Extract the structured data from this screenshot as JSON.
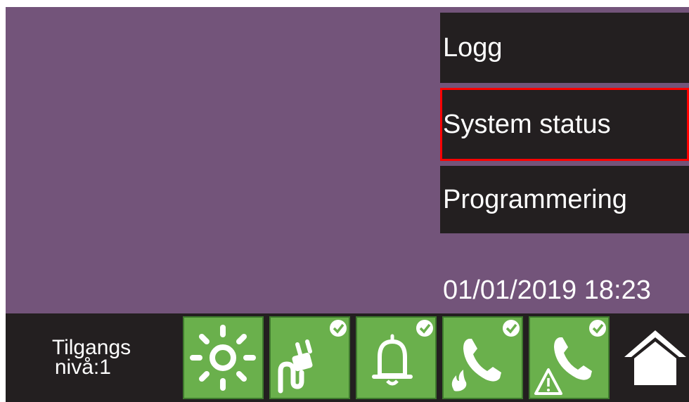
{
  "menu": {
    "items": [
      {
        "label": "Logg"
      },
      {
        "label": "System status",
        "selected": true
      },
      {
        "label": "Programmering"
      }
    ]
  },
  "datetime": "01/01/2019 18:23",
  "status_bar": {
    "access_line1": "Tilgangs",
    "access_line2": "nivå:1",
    "tiles": [
      {
        "icon": "sun-icon",
        "checked": false
      },
      {
        "icon": "power-plug-icon",
        "checked": true
      },
      {
        "icon": "bell-icon",
        "checked": true
      },
      {
        "icon": "phone-fire-icon",
        "checked": true
      },
      {
        "icon": "phone-warning-icon",
        "checked": true
      }
    ],
    "home_icon": "home-icon"
  },
  "colors": {
    "background": "#73547a",
    "panel": "#231f20",
    "tile_green": "#6ab04c",
    "selected_border": "#ff0000",
    "text": "#ffffff"
  }
}
